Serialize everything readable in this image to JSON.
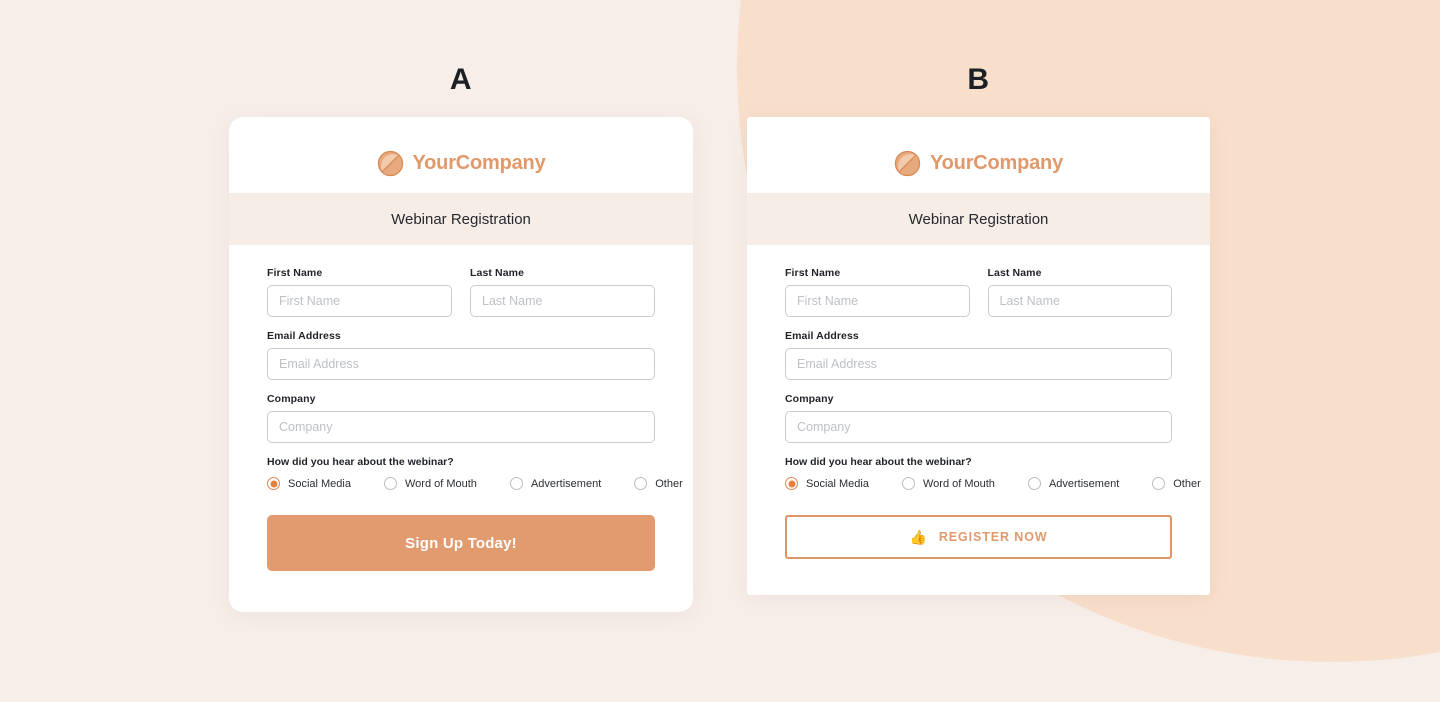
{
  "theme": {
    "page_background": "#F7EEE9",
    "accent_orange": "#E29B6E",
    "logo_orange": "#E0996B",
    "peach_circle": "#F8DFCB",
    "soft_circle": "#F9EAE2",
    "banner_background": "#F7EDE7",
    "radio_selected": "#E5813F"
  },
  "brand": {
    "name": "YourCompany",
    "logo_icon": "circle-slash-logo-icon"
  },
  "form": {
    "banner_title": "Webinar Registration",
    "fields": [
      {
        "label": "First Name",
        "placeholder": "First Name",
        "value": "",
        "width": "half"
      },
      {
        "label": "Last Name",
        "placeholder": "Last Name",
        "value": "",
        "width": "half"
      },
      {
        "label": "Email Address",
        "placeholder": "Email Address",
        "value": "",
        "width": "full"
      },
      {
        "label": "Company",
        "placeholder": "Company",
        "value": "",
        "width": "full"
      }
    ],
    "radio_question": "How did you hear about the webinar?",
    "radio_options": [
      {
        "label": "Social Media",
        "selected": true
      },
      {
        "label": "Word of Mouth",
        "selected": false
      },
      {
        "label": "Advertisement",
        "selected": false
      },
      {
        "label": "Other",
        "selected": false
      }
    ]
  },
  "variants": {
    "a": {
      "letter": "A",
      "cta_label": "Sign Up Today!",
      "cta_style": "solid"
    },
    "b": {
      "letter": "B",
      "cta_label": "REGISTER NOW",
      "cta_icon": "thumbs-up-icon",
      "cta_icon_glyph": "👍",
      "cta_style": "outline"
    }
  }
}
